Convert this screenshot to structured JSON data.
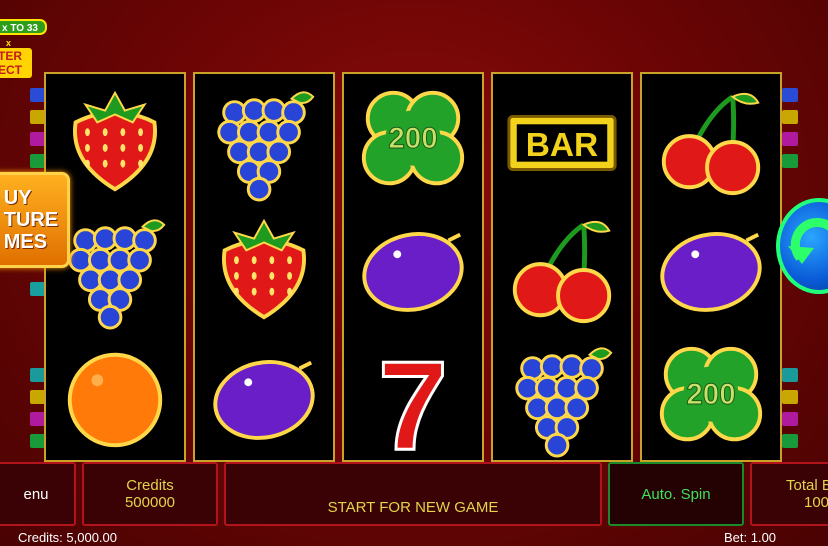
{
  "logo": {
    "text_lines": [
      "x TO 33",
      "x",
      "TER",
      "ECT"
    ]
  },
  "buy_feature": {
    "label": "UY\nTURE\nMES"
  },
  "reels": [
    [
      "strawberry",
      "grapes",
      "orange"
    ],
    [
      "grapes",
      "strawberry",
      "plum"
    ],
    [
      "clover-200",
      "plum",
      "seven"
    ],
    [
      "bar",
      "cherry",
      "grapes"
    ],
    [
      "cherry",
      "plum",
      "clover-200"
    ]
  ],
  "symbols": {
    "clover_value": "200",
    "bar_text": "BAR",
    "seven_text": "7"
  },
  "bottom_bar": {
    "menu_label": "enu",
    "credits_label": "Credits",
    "credits_value": "500000",
    "start_label": "START FOR NEW GAME",
    "autospin_label": "Auto. Spin",
    "total_bet_label": "Total B",
    "total_bet_value": "100"
  },
  "status_line": {
    "credits": "Credits: 5,000.00",
    "bet": "Bet: 1.00"
  },
  "colors": {
    "accent_gold": "#c9a227",
    "text_yellow": "#e2d54a",
    "spin_green": "#1fff7a"
  }
}
